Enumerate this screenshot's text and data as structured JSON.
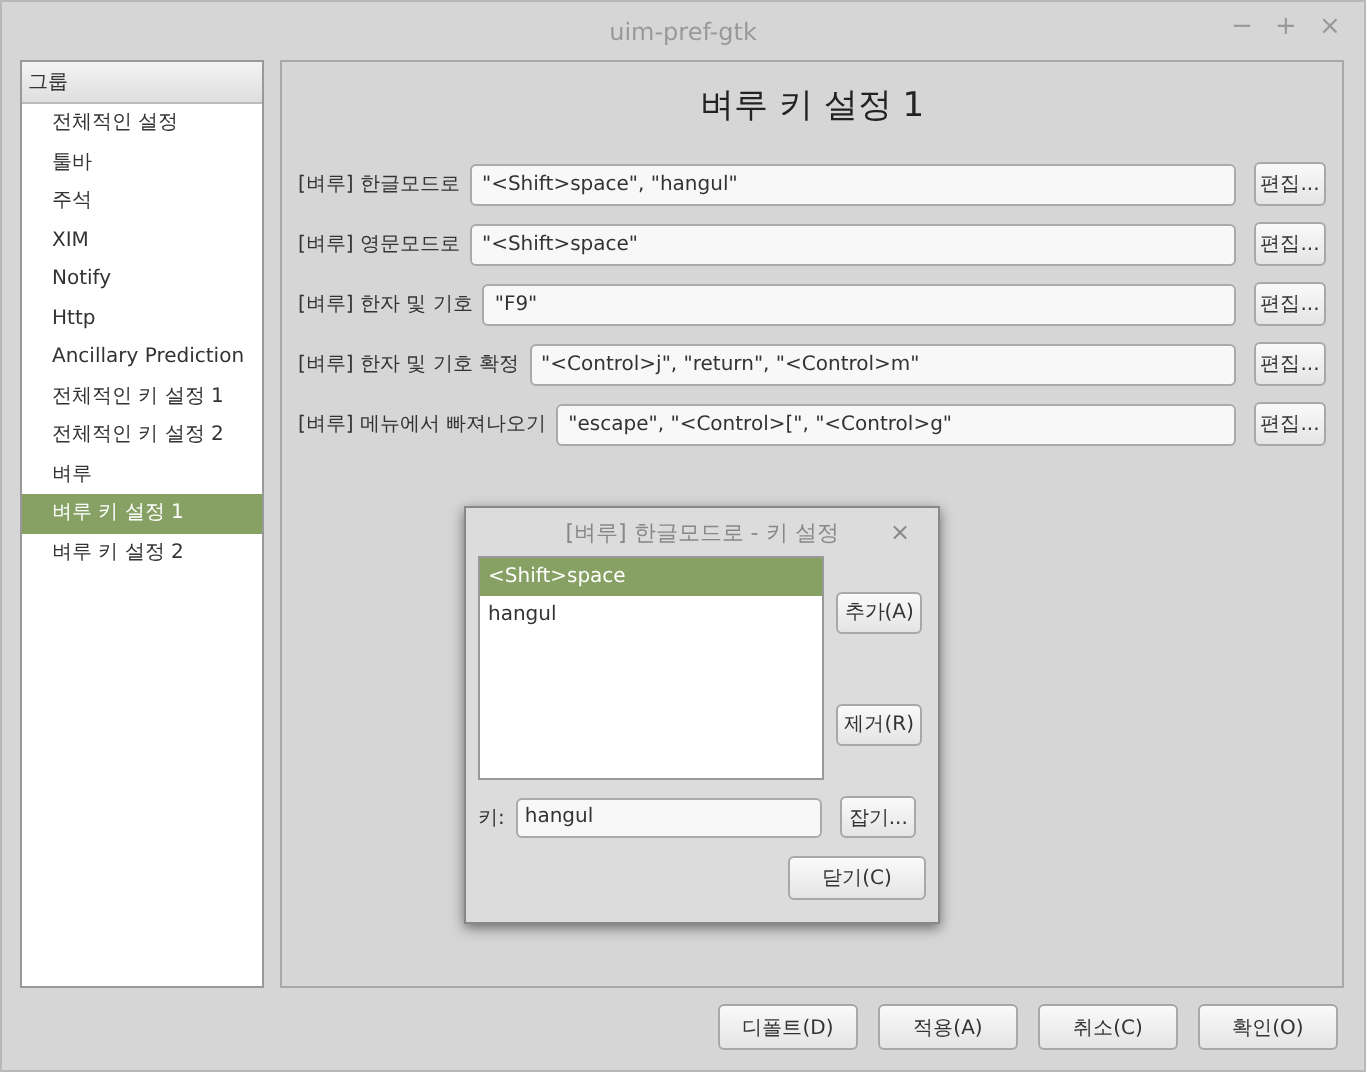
{
  "window": {
    "title": "uim-pref-gtk",
    "controls": [
      "−",
      "+",
      "×"
    ]
  },
  "sidebar": {
    "header": "그룹",
    "items": [
      {
        "label": "전체적인 설정",
        "selected": false
      },
      {
        "label": "툴바",
        "selected": false
      },
      {
        "label": "주석",
        "selected": false
      },
      {
        "label": "XIM",
        "selected": false
      },
      {
        "label": "Notify",
        "selected": false
      },
      {
        "label": "Http",
        "selected": false
      },
      {
        "label": "Ancillary Prediction",
        "selected": false
      },
      {
        "label": "전체적인 키 설정 1",
        "selected": false
      },
      {
        "label": "전체적인 키 설정 2",
        "selected": false
      },
      {
        "label": "벼루",
        "selected": false
      },
      {
        "label": "벼루 키 설정 1",
        "selected": true
      },
      {
        "label": "벼루 키 설정 2",
        "selected": false
      }
    ]
  },
  "panel": {
    "title": "벼루 키 설정 1",
    "rows": [
      {
        "label": "[벼루] 한글모드로",
        "value": "\"<Shift>space\", \"hangul\"",
        "button": "편집..."
      },
      {
        "label": "[벼루] 영문모드로",
        "value": "\"<Shift>space\"",
        "button": "편집..."
      },
      {
        "label": "[벼루] 한자 및 기호",
        "value": "\"F9\"",
        "button": "편집..."
      },
      {
        "label": "[벼루] 한자 및 기호 확정",
        "value": "\"<Control>j\", \"return\", \"<Control>m\"",
        "button": "편집..."
      },
      {
        "label": "[벼루] 메뉴에서 빠져나오기",
        "value": "\"escape\", \"<Control>[\", \"<Control>g\"",
        "button": "편집..."
      }
    ]
  },
  "dialog": {
    "title": "[벼루] 한글모드로 - 키 설정",
    "close": "×",
    "keys": [
      {
        "label": "<Shift>space",
        "selected": true
      },
      {
        "label": "hangul",
        "selected": false
      }
    ],
    "add_button": "추가(A)",
    "remove_button": "제거(R)",
    "key_label": "키:",
    "key_value": "hangul",
    "grab_button": "잡기...",
    "close_button": "닫기(C)"
  },
  "buttons": [
    "디폴트(D)",
    "적용(A)",
    "취소(C)",
    "확인(O)"
  ]
}
